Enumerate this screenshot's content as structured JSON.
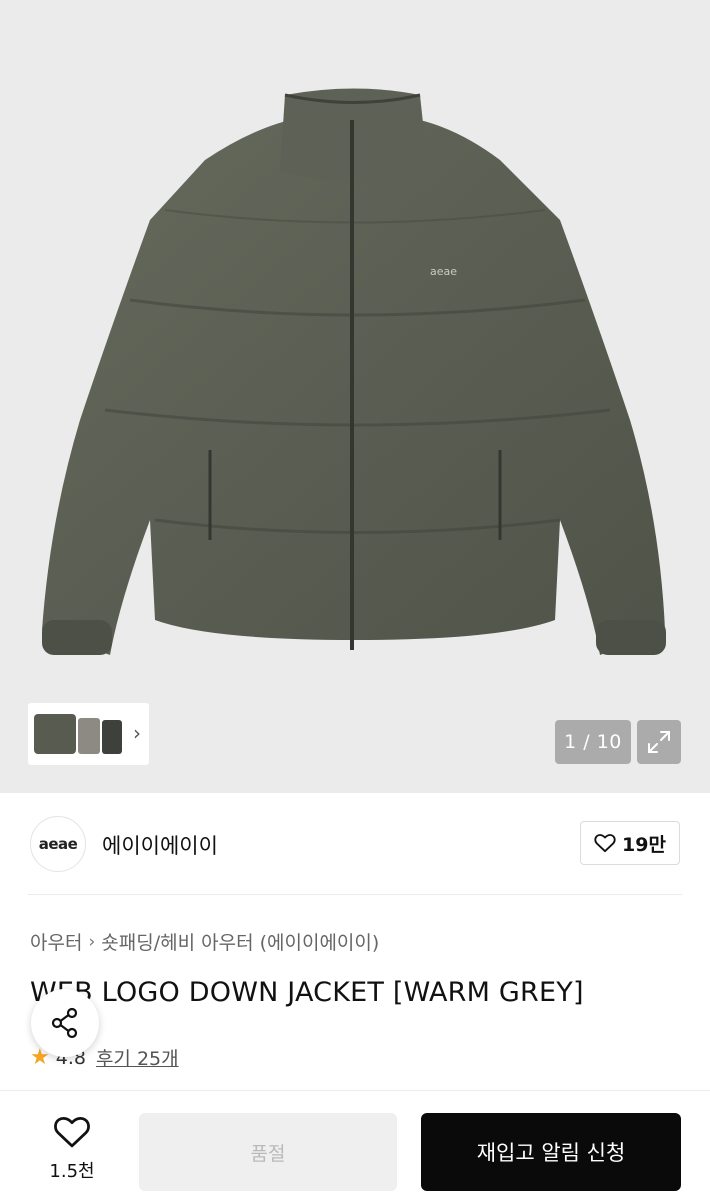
{
  "gallery": {
    "counter": "1 / 10",
    "thumb_arrow": "›"
  },
  "brand": {
    "logo_text": "aeae",
    "name": "에이이에이이",
    "like_count": "19만"
  },
  "product": {
    "breadcrumb": [
      "아우터",
      "숏패딩/헤비 아우터 (에이이에이이)"
    ],
    "breadcrumb_sep": "›",
    "title": "WEB LOGO DOWN JACKET [WARM GREY]",
    "chest_logo": "aeae",
    "rating": "4.8",
    "review_text": "후기 25개"
  },
  "bottom_bar": {
    "wish_count": "1.5천",
    "soldout_label": "품절",
    "notify_label": "재입고 알림 신청"
  },
  "colors": {
    "jacket": "#5a5e52",
    "jacket_dark": "#454940",
    "star": "#f5a623",
    "primary_button": "#0a0a0a",
    "disabled_button": "#efefef"
  },
  "icons": [
    "expand-icon",
    "heart-icon",
    "share-icon",
    "star-icon",
    "chevron-right-icon"
  ]
}
